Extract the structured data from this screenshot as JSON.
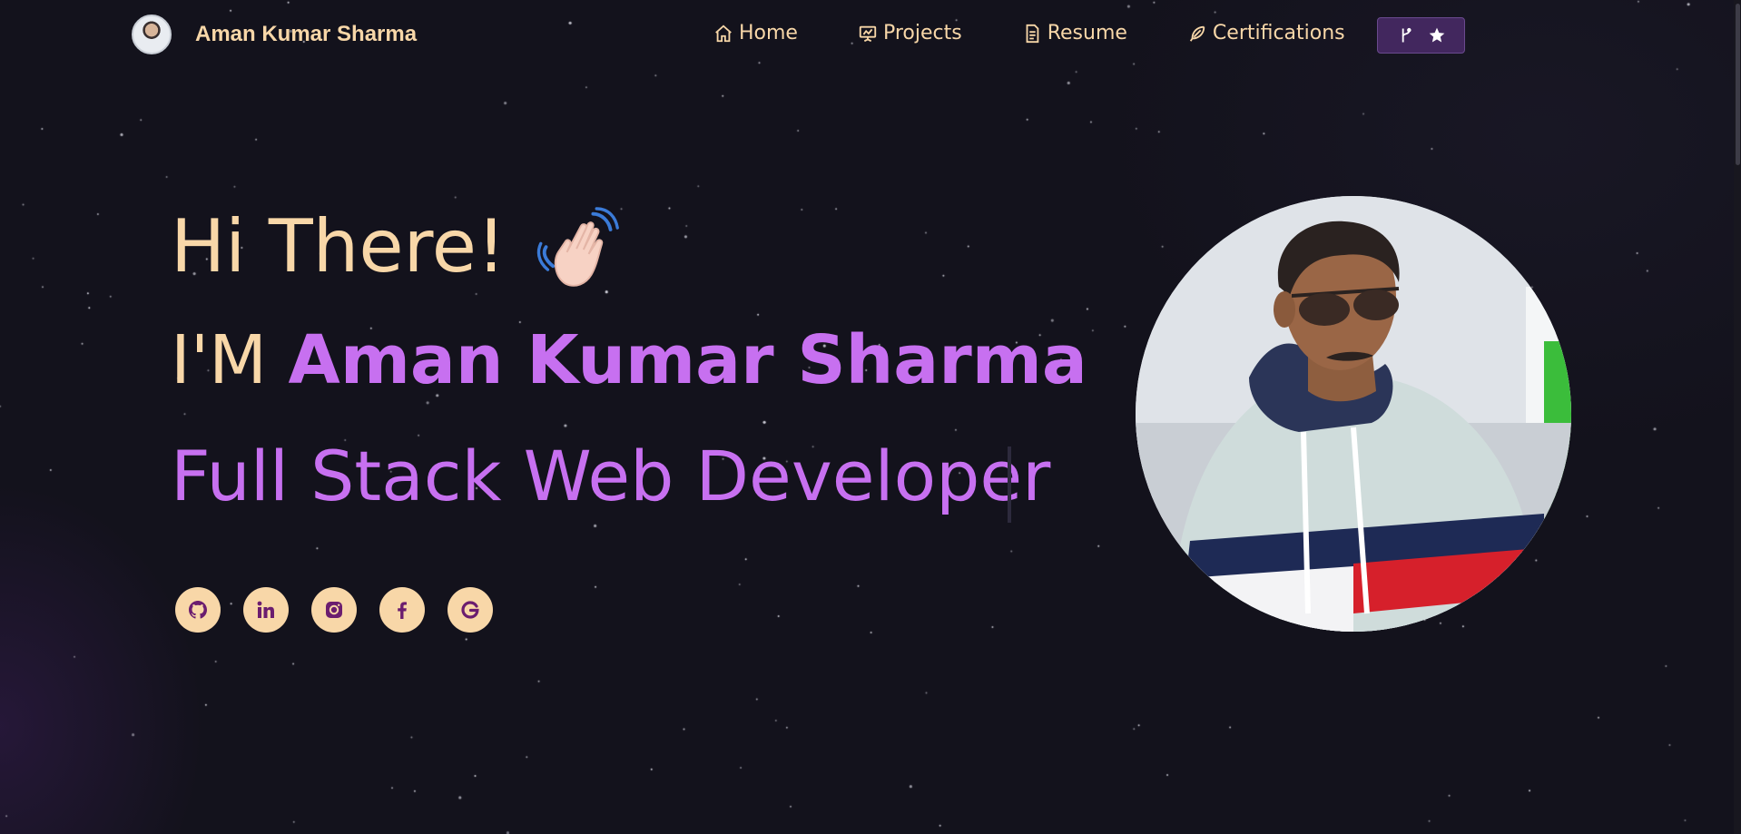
{
  "navbar": {
    "brand_name": "Aman Kumar Sharma",
    "links": [
      {
        "label": "Home",
        "icon": "home-icon"
      },
      {
        "label": "Projects",
        "icon": "presentation-icon"
      },
      {
        "label": "Resume",
        "icon": "document-icon"
      },
      {
        "label": "Certifications",
        "icon": "feather-icon"
      }
    ],
    "fork_button": {
      "icons": [
        "git-fork-icon",
        "star-icon"
      ]
    }
  },
  "hero": {
    "greeting": "Hi There!",
    "intro_prefix": "I'M ",
    "intro_name": "Aman Kumar Sharma",
    "role": "Full Stack Web Developer",
    "wave_icon": "waving-hand-icon"
  },
  "socials": [
    {
      "icon": "github-icon"
    },
    {
      "icon": "linkedin-icon"
    },
    {
      "icon": "instagram-icon"
    },
    {
      "icon": "facebook-icon"
    },
    {
      "icon": "google-icon"
    }
  ],
  "colors": {
    "background": "#13121c",
    "cream": "#f8d7a8",
    "purple": "#c770f0",
    "button": "#42275e"
  }
}
